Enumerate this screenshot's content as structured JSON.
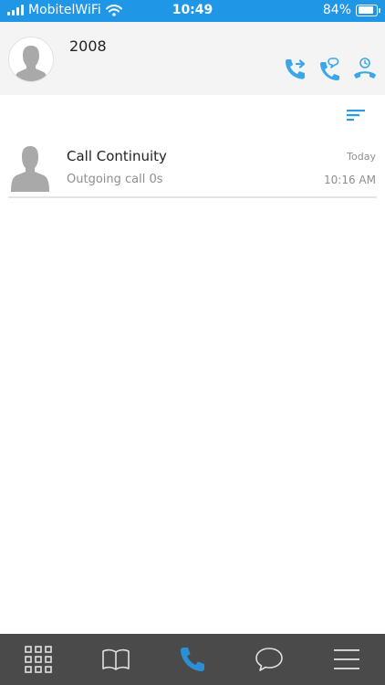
{
  "status_bar": {
    "carrier": "MobitelWiFi",
    "time": "10:49",
    "battery": "84%",
    "battery_level": 0.84
  },
  "header": {
    "user_name": "2008",
    "actions": [
      {
        "icon": "call-forward-icon"
      },
      {
        "icon": "call-message-icon"
      },
      {
        "icon": "call-history-icon"
      }
    ]
  },
  "filter": {
    "icon": "filter-sort-icon"
  },
  "call_log": [
    {
      "name": "Call Continuity",
      "detail": "Outgoing call 0s",
      "date": "Today",
      "time": "10:16 AM"
    }
  ],
  "tabbar": {
    "tabs": [
      {
        "icon": "keypad-icon",
        "active": false
      },
      {
        "icon": "contacts-book-icon",
        "active": false
      },
      {
        "icon": "phone-icon",
        "active": true
      },
      {
        "icon": "chat-bubble-icon",
        "active": false
      },
      {
        "icon": "menu-icon",
        "active": false
      }
    ]
  },
  "colors": {
    "accent": "#1f97e6",
    "icon_blue": "#3aa7ea",
    "tabbar_bg": "#4a4a4a",
    "tab_icon": "#e0e0e0"
  }
}
